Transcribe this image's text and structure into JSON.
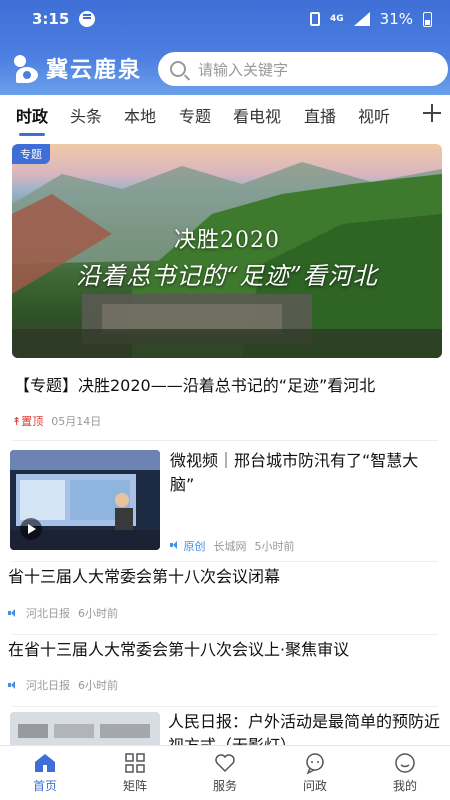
{
  "status": {
    "time": "3:15",
    "network": "4G",
    "battery": "31%"
  },
  "header": {
    "logo": "冀云鹿泉",
    "search_placeholder": "请输入关键字"
  },
  "tabs": [
    "时政",
    "头条",
    "本地",
    "专题",
    "看电视",
    "直播",
    "视听"
  ],
  "colors": {
    "brand": "#3f6fd6",
    "pin": "#e0382e",
    "tag": "#4a90e2"
  },
  "feed": {
    "featured": {
      "badge": "专题",
      "banner_title": "决胜2020",
      "banner_sub": "沿着总书记的“足迹”看河北",
      "title": "【专题】决胜2020——沿着总书记的“足迹”看河北",
      "pin": "置顶",
      "date": "05月14日"
    },
    "video": {
      "title": "微视频｜邢台城市防汛有了“智慧大脑”",
      "tag": "原创",
      "source": "长城网",
      "time": "5小时前"
    },
    "news1": {
      "title": "省十三届人大常委会第十八次会议闭幕",
      "source": "河北日报",
      "time": "6小时前"
    },
    "news2": {
      "title": "在省十三届人大常委会第十八次会议上·聚焦审议",
      "source": "河北日报",
      "time": "6小时前"
    },
    "news3": {
      "title": "人民日报：户外活动是最简单的预防近视方式（无影灯）"
    }
  },
  "bottom_nav": [
    {
      "label": "首页",
      "icon": "home-icon"
    },
    {
      "label": "矩阵",
      "icon": "grid-icon"
    },
    {
      "label": "服务",
      "icon": "heart-icon"
    },
    {
      "label": "问政",
      "icon": "chat-icon"
    },
    {
      "label": "我的",
      "icon": "user-icon"
    }
  ]
}
